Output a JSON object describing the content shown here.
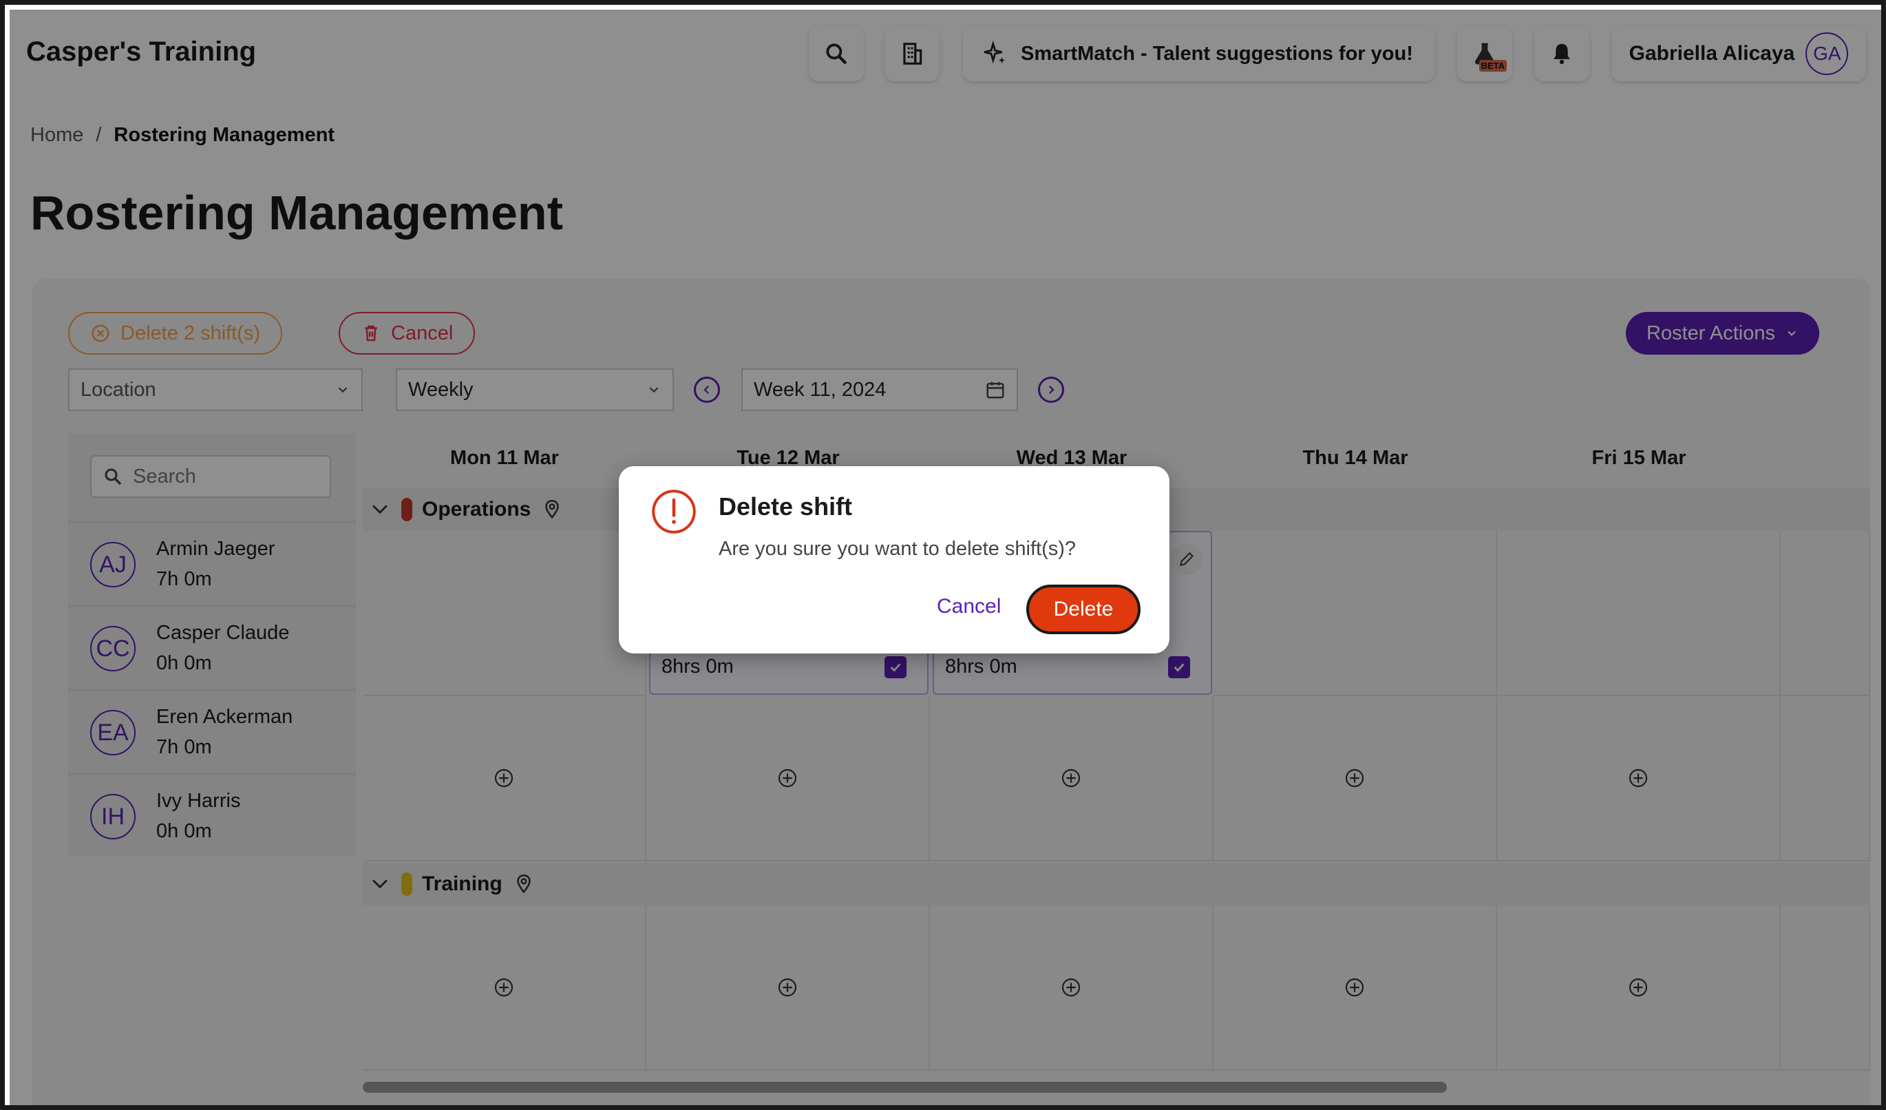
{
  "header": {
    "app_title": "Casper's Training",
    "smartmatch_label": "SmartMatch - Talent suggestions for you!",
    "beta_badge": "BETA",
    "user_name": "Gabriella Alicaya",
    "user_initials": "GA"
  },
  "breadcrumb": {
    "home": "Home",
    "separator": "/",
    "current": "Rostering Management"
  },
  "page_title": "Rostering Management",
  "toolbar": {
    "delete_label": "Delete 2 shift(s)",
    "cancel_label": "Cancel",
    "roster_actions_label": "Roster Actions",
    "location_value": "Location",
    "view_value": "Weekly",
    "week_value": "Week 11, 2024"
  },
  "sidebar": {
    "search_placeholder": "Search",
    "employees": [
      {
        "initials": "AJ",
        "name": "Armin Jaeger",
        "hours": "7h 0m"
      },
      {
        "initials": "CC",
        "name": "Casper Claude",
        "hours": "0h 0m"
      },
      {
        "initials": "EA",
        "name": "Eren Ackerman",
        "hours": "7h 0m"
      },
      {
        "initials": "IH",
        "name": "Ivy Harris",
        "hours": "0h 0m"
      }
    ]
  },
  "schedule": {
    "days": [
      "Mon 11 Mar",
      "Tue 12 Mar",
      "Wed 13 Mar",
      "Thu 14 Mar",
      "Fri 15 Mar"
    ],
    "groups": [
      {
        "name": "Operations",
        "color": "#c0392b"
      },
      {
        "name": "Training",
        "color": "#e5c21b"
      }
    ],
    "shifts": [
      {
        "hours": "8hrs 0m"
      },
      {
        "hours": "8hrs 0m"
      }
    ]
  },
  "modal": {
    "title": "Delete shift",
    "message": "Are you sure you want to delete shift(s)?",
    "cancel_label": "Cancel",
    "delete_label": "Delete"
  },
  "colors": {
    "accent": "#5b21b6",
    "danger": "#e0390e",
    "warning": "#f5a24b"
  }
}
